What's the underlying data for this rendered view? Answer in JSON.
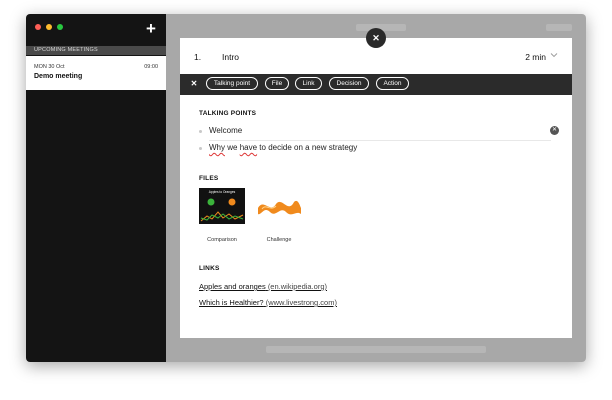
{
  "sidebar": {
    "section_header": "UPCOMING MEETINGS",
    "meeting": {
      "date": "MON 30 Oct",
      "time": "09:00",
      "title": "Demo meeting"
    }
  },
  "agenda_item": {
    "number": "1.",
    "title": "Intro",
    "duration": "2 min"
  },
  "toolbar": {
    "items": [
      "Talking point",
      "File",
      "Link",
      "Decision",
      "Action"
    ]
  },
  "talking_points": {
    "label": "TALKING POINTS",
    "items": [
      "Welcome",
      "Why we have to decide on a new strategy"
    ]
  },
  "files": {
    "label": "FILES",
    "items": [
      {
        "caption": "Comparison",
        "thumb_title": "Apples to Oranges"
      },
      {
        "caption": "Challenge"
      }
    ]
  },
  "links": {
    "label": "LINKS",
    "items": [
      {
        "text": "Apples and oranges",
        "source": "(en.wikipedia.org)"
      },
      {
        "text": "Which is Healthier?",
        "source": "(www.livestrong.com)"
      }
    ]
  },
  "colors": {
    "traffic_red": "#ff5f57",
    "traffic_yellow": "#febc2e",
    "traffic_green": "#28c840",
    "toolbar_bg": "#2b2b2b"
  }
}
